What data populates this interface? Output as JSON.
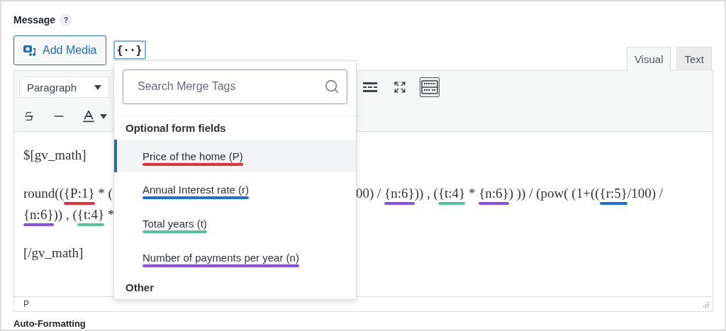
{
  "field": {
    "label": "Message",
    "help": "?"
  },
  "add_media": {
    "label": "Add Media"
  },
  "merge_tag_button": {
    "label": "{··}",
    "active": true
  },
  "editor_tabs": [
    {
      "label": "Visual",
      "selected": true
    },
    {
      "label": "Text",
      "selected": false
    }
  ],
  "toolbar": {
    "format": "Paragraph",
    "toolbar_toggle_pressed": true
  },
  "content": {
    "paragraphs": [
      {
        "lines": [
          {
            "left": [
              {
                "text": "$[gv_math]"
              }
            ]
          }
        ]
      },
      {
        "lines": [
          {
            "left": [
              {
                "text": "round(("
              },
              {
                "text": "{P:1}",
                "color": "#e8303c"
              },
              {
                "text": " * ("
              }
            ],
            "right": [
              {
                "text": "00) / "
              },
              {
                "text": "{n:6}",
                "color": "#8a4cf0"
              },
              {
                "text": ")) , ("
              },
              {
                "text": "{t:4}",
                "color": "#56c49a"
              },
              {
                "text": " * "
              },
              {
                "text": "{n:6}",
                "color": "#8a4cf0"
              },
              {
                "text": ") )) / (pow( (1+(("
              },
              {
                "text": "{r:5}",
                "color": "#1a6fe0"
              },
              {
                "text": "/100) /"
              }
            ]
          },
          {
            "left": [
              {
                "text": "{n:6}",
                "color": "#8a4cf0"
              },
              {
                "text": ")) , ("
              },
              {
                "text": "{t:4}",
                "color": "#56c49a"
              },
              {
                "text": " *"
              }
            ]
          }
        ]
      },
      {
        "lines": [
          {
            "left": [
              {
                "text": "[/gv_math]"
              }
            ]
          }
        ]
      }
    ]
  },
  "status_path": "P",
  "merge_tags": {
    "placeholder": "Search Merge Tags",
    "section_title": "Optional form fields",
    "items": [
      {
        "label": "Price of the home (P)",
        "color": "#e8303c",
        "selected": true
      },
      {
        "label": "Annual Interest rate (r)",
        "color": "#1a6fe0",
        "selected": false
      },
      {
        "label": "Total years (t)",
        "color": "#56c49a",
        "selected": false
      },
      {
        "label": "Number of payments per year (n)",
        "color": "#8a4cf0",
        "selected": false
      }
    ],
    "next_section_title": "Other"
  },
  "next_field": {
    "label": "Auto-Formatting"
  }
}
